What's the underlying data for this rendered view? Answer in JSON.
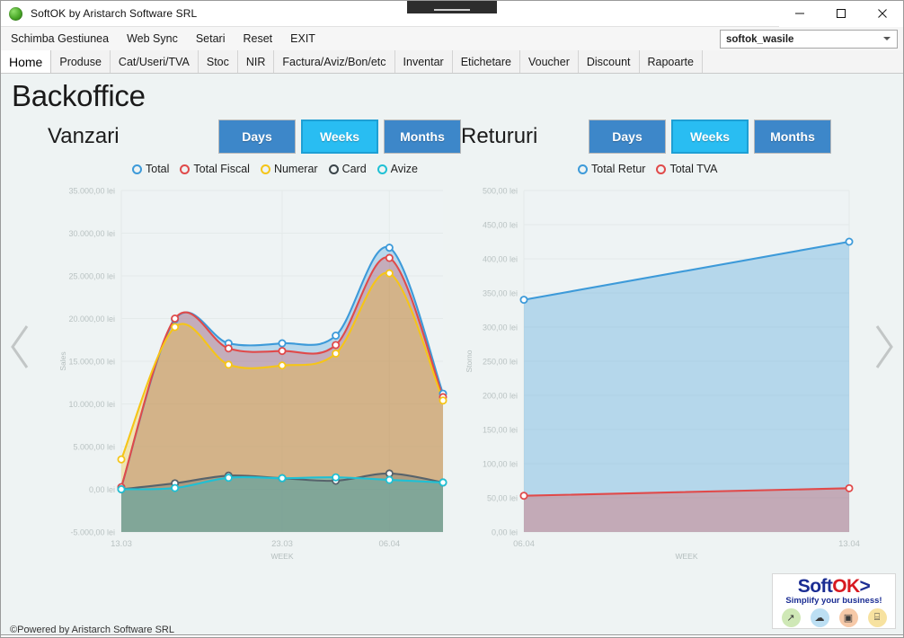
{
  "window": {
    "title": "SoftOK by Aristarch Software SRL",
    "icon": "green-sphere-icon",
    "minimize_label": "—",
    "maximize_label": "□",
    "close_label": "✕"
  },
  "menubar": {
    "items": [
      {
        "label": "Schimba Gestiunea"
      },
      {
        "label": "Web Sync"
      },
      {
        "label": "Setari"
      },
      {
        "label": "Reset"
      },
      {
        "label": "EXIT"
      }
    ],
    "gestiune_select": {
      "value": "softok_wasile"
    }
  },
  "tabs": [
    {
      "label": "Home",
      "active": true
    },
    {
      "label": "Produse",
      "active": false
    },
    {
      "label": "Cat/Useri/TVA",
      "active": false
    },
    {
      "label": "Stoc",
      "active": false
    },
    {
      "label": "NIR",
      "active": false
    },
    {
      "label": "Factura/Aviz/Bon/etc",
      "active": false
    },
    {
      "label": "Inventar",
      "active": false
    },
    {
      "label": "Etichetare",
      "active": false
    },
    {
      "label": "Voucher",
      "active": false
    },
    {
      "label": "Discount",
      "active": false
    },
    {
      "label": "Rapoarte",
      "active": false
    }
  ],
  "page": {
    "title": "Backoffice"
  },
  "nav": {
    "prev_icon": "chevron-left-icon",
    "next_icon": "chevron-right-icon"
  },
  "panels": {
    "sales": {
      "title": "Vanzari",
      "range_buttons": [
        {
          "label": "Days",
          "selected": false
        },
        {
          "label": "Weeks",
          "selected": true
        },
        {
          "label": "Months",
          "selected": false
        }
      ]
    },
    "returns": {
      "title": "Retururi",
      "range_buttons": [
        {
          "label": "Days",
          "selected": false
        },
        {
          "label": "Weeks",
          "selected": true
        },
        {
          "label": "Months",
          "selected": false
        }
      ]
    }
  },
  "colors": {
    "total": "#3d9ad9",
    "total_fiscal": "#e04a4a",
    "numerar": "#f5c518",
    "card": "#57636b",
    "avize": "#1fc0d4",
    "button": "#3d87c9",
    "button_selected": "#29bdf2",
    "brand_blue": "#1b2d93",
    "brand_red": "#d71920"
  },
  "chart_data": [
    {
      "id": "sales-chart",
      "type": "area",
      "title": "Vanzari",
      "xlabel": "WEEK",
      "ylabel": "Sales",
      "ylim": [
        -5000,
        35000
      ],
      "ytick_step": 5000,
      "ytick_labels": [
        "35.000,00 lei",
        "30.000,00 lei",
        "25.000,00 lei",
        "20.000,00 lei",
        "15.000,00 lei",
        "10.000,00 lei",
        "5.000,00 lei",
        "0,00 lei",
        "-5.000,00 lei"
      ],
      "ytick_values": [
        35000,
        30000,
        25000,
        20000,
        15000,
        10000,
        5000,
        0,
        -5000
      ],
      "x": [
        0,
        1,
        2,
        3,
        4,
        5,
        6
      ],
      "xtick_labels": [
        "13.03",
        "23.03",
        "06.04"
      ],
      "xtick_positions": [
        0,
        3,
        5
      ],
      "grid": true,
      "legend_position": "top",
      "series": [
        {
          "name": "Total",
          "color": "#3d9ad9",
          "values": [
            250,
            19900,
            17100,
            17100,
            18000,
            28300,
            11200
          ]
        },
        {
          "name": "Total Fiscal",
          "color": "#e04a4a",
          "values": [
            250,
            20000,
            16500,
            16200,
            16900,
            27100,
            10800
          ]
        },
        {
          "name": "Numerar",
          "color": "#f5c518",
          "values": [
            3500,
            19000,
            14600,
            14500,
            15900,
            25300,
            10400
          ]
        },
        {
          "name": "Card",
          "color": "#57636b",
          "values": [
            0,
            700,
            1600,
            1300,
            1000,
            1850,
            800
          ]
        },
        {
          "name": "Avize",
          "color": "#1fc0d4",
          "values": [
            0,
            150,
            1350,
            1300,
            1400,
            1100,
            800
          ]
        }
      ]
    },
    {
      "id": "returns-chart",
      "type": "area",
      "title": "Retururi",
      "xlabel": "WEEK",
      "ylabel": "Storno",
      "ylim": [
        0,
        500
      ],
      "ytick_step": 50,
      "ytick_labels": [
        "500,00 lei",
        "450,00 lei",
        "400,00 lei",
        "350,00 lei",
        "300,00 lei",
        "250,00 lei",
        "200,00 lei",
        "150,00 lei",
        "100,00 lei",
        "50,00 lei",
        "0,00 lei"
      ],
      "ytick_values": [
        500,
        450,
        400,
        350,
        300,
        250,
        200,
        150,
        100,
        50,
        0
      ],
      "x": [
        0,
        1
      ],
      "xtick_labels": [
        "06.04",
        "13.04"
      ],
      "xtick_positions": [
        0,
        1
      ],
      "grid": true,
      "legend_position": "top",
      "series": [
        {
          "name": "Total Retur",
          "color": "#3d9ad9",
          "values": [
            340,
            425
          ]
        },
        {
          "name": "Total TVA",
          "color": "#e04a4a",
          "values": [
            53,
            64
          ]
        }
      ]
    }
  ],
  "footer": {
    "credit": "©Powered by Aristarch Software SRL",
    "brand": {
      "word_1": "Soft",
      "word_2": "OK",
      "word_3": ">",
      "tagline": "Simplify your business!",
      "icons": [
        {
          "name": "chart-icon",
          "glyph": "↗"
        },
        {
          "name": "cloud-icon",
          "glyph": "☁"
        },
        {
          "name": "monitor-icon",
          "glyph": "▣"
        },
        {
          "name": "basket-icon",
          "glyph": "⌸"
        }
      ]
    }
  }
}
